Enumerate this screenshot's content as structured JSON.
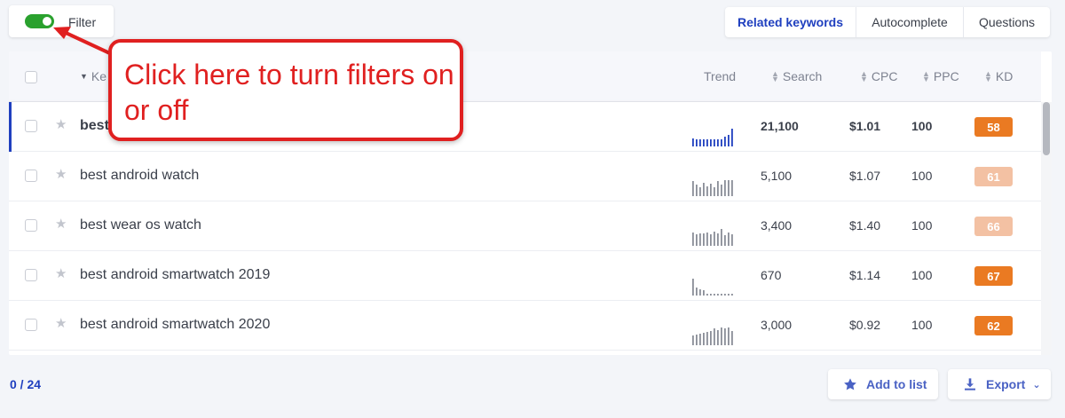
{
  "filter": {
    "label": "Filter",
    "enabled": true
  },
  "tabs": [
    {
      "label": "Related keywords",
      "active": true
    },
    {
      "label": "Autocomplete",
      "active": false
    },
    {
      "label": "Questions",
      "active": false
    }
  ],
  "table": {
    "headers": {
      "keyword": "Ke",
      "trend": "Trend",
      "search": "Search",
      "cpc": "CPC",
      "ppc": "PPC",
      "kd": "KD"
    },
    "rows": [
      {
        "keyword": "best",
        "search": "21,100",
        "cpc": "$1.01",
        "ppc": "100",
        "kd": "58",
        "kd_color": "#ea7a22",
        "selected": true,
        "trend": [
          0.45,
          0.4,
          0.4,
          0.4,
          0.4,
          0.4,
          0.4,
          0.4,
          0.4,
          0.55,
          0.65,
          1.0
        ]
      },
      {
        "keyword": "best android watch",
        "search": "5,100",
        "cpc": "$1.07",
        "ppc": "100",
        "kd": "61",
        "kd_color": "#f3c1a3",
        "selected": false,
        "trend": [
          0.85,
          0.65,
          0.5,
          0.75,
          0.55,
          0.7,
          0.5,
          0.85,
          0.65,
          0.9,
          0.9,
          0.9
        ]
      },
      {
        "keyword": "best wear os watch",
        "search": "3,400",
        "cpc": "$1.40",
        "ppc": "100",
        "kd": "66",
        "kd_color": "#f3c1a3",
        "selected": false,
        "trend": [
          0.75,
          0.65,
          0.7,
          0.7,
          0.75,
          0.65,
          0.8,
          0.7,
          0.95,
          0.6,
          0.75,
          0.65
        ]
      },
      {
        "keyword": "best android smartwatch 2019",
        "search": "670",
        "cpc": "$1.14",
        "ppc": "100",
        "kd": "67",
        "kd_color": "#ea7a22",
        "selected": false,
        "trend": [
          0.95,
          0.45,
          0.35,
          0.3,
          0.1,
          0.1,
          0.1,
          0.1,
          0.1,
          0.1,
          0.1,
          0.1
        ]
      },
      {
        "keyword": "best android smartwatch 2020",
        "search": "3,000",
        "cpc": "$0.92",
        "ppc": "100",
        "kd": "62",
        "kd_color": "#ea7a22",
        "selected": false,
        "trend": [
          0.55,
          0.6,
          0.65,
          0.7,
          0.75,
          0.8,
          0.95,
          0.85,
          1.0,
          0.95,
          1.0,
          0.8
        ]
      }
    ]
  },
  "footer": {
    "count": "0 / 24",
    "add_to_list": "Add to list",
    "export": "Export"
  },
  "callout": {
    "text": "Click here to turn filters on or off"
  },
  "colors": {
    "accent": "#1f3fbf",
    "toggle_on": "#2aa12e",
    "callout_red": "#e02020"
  }
}
